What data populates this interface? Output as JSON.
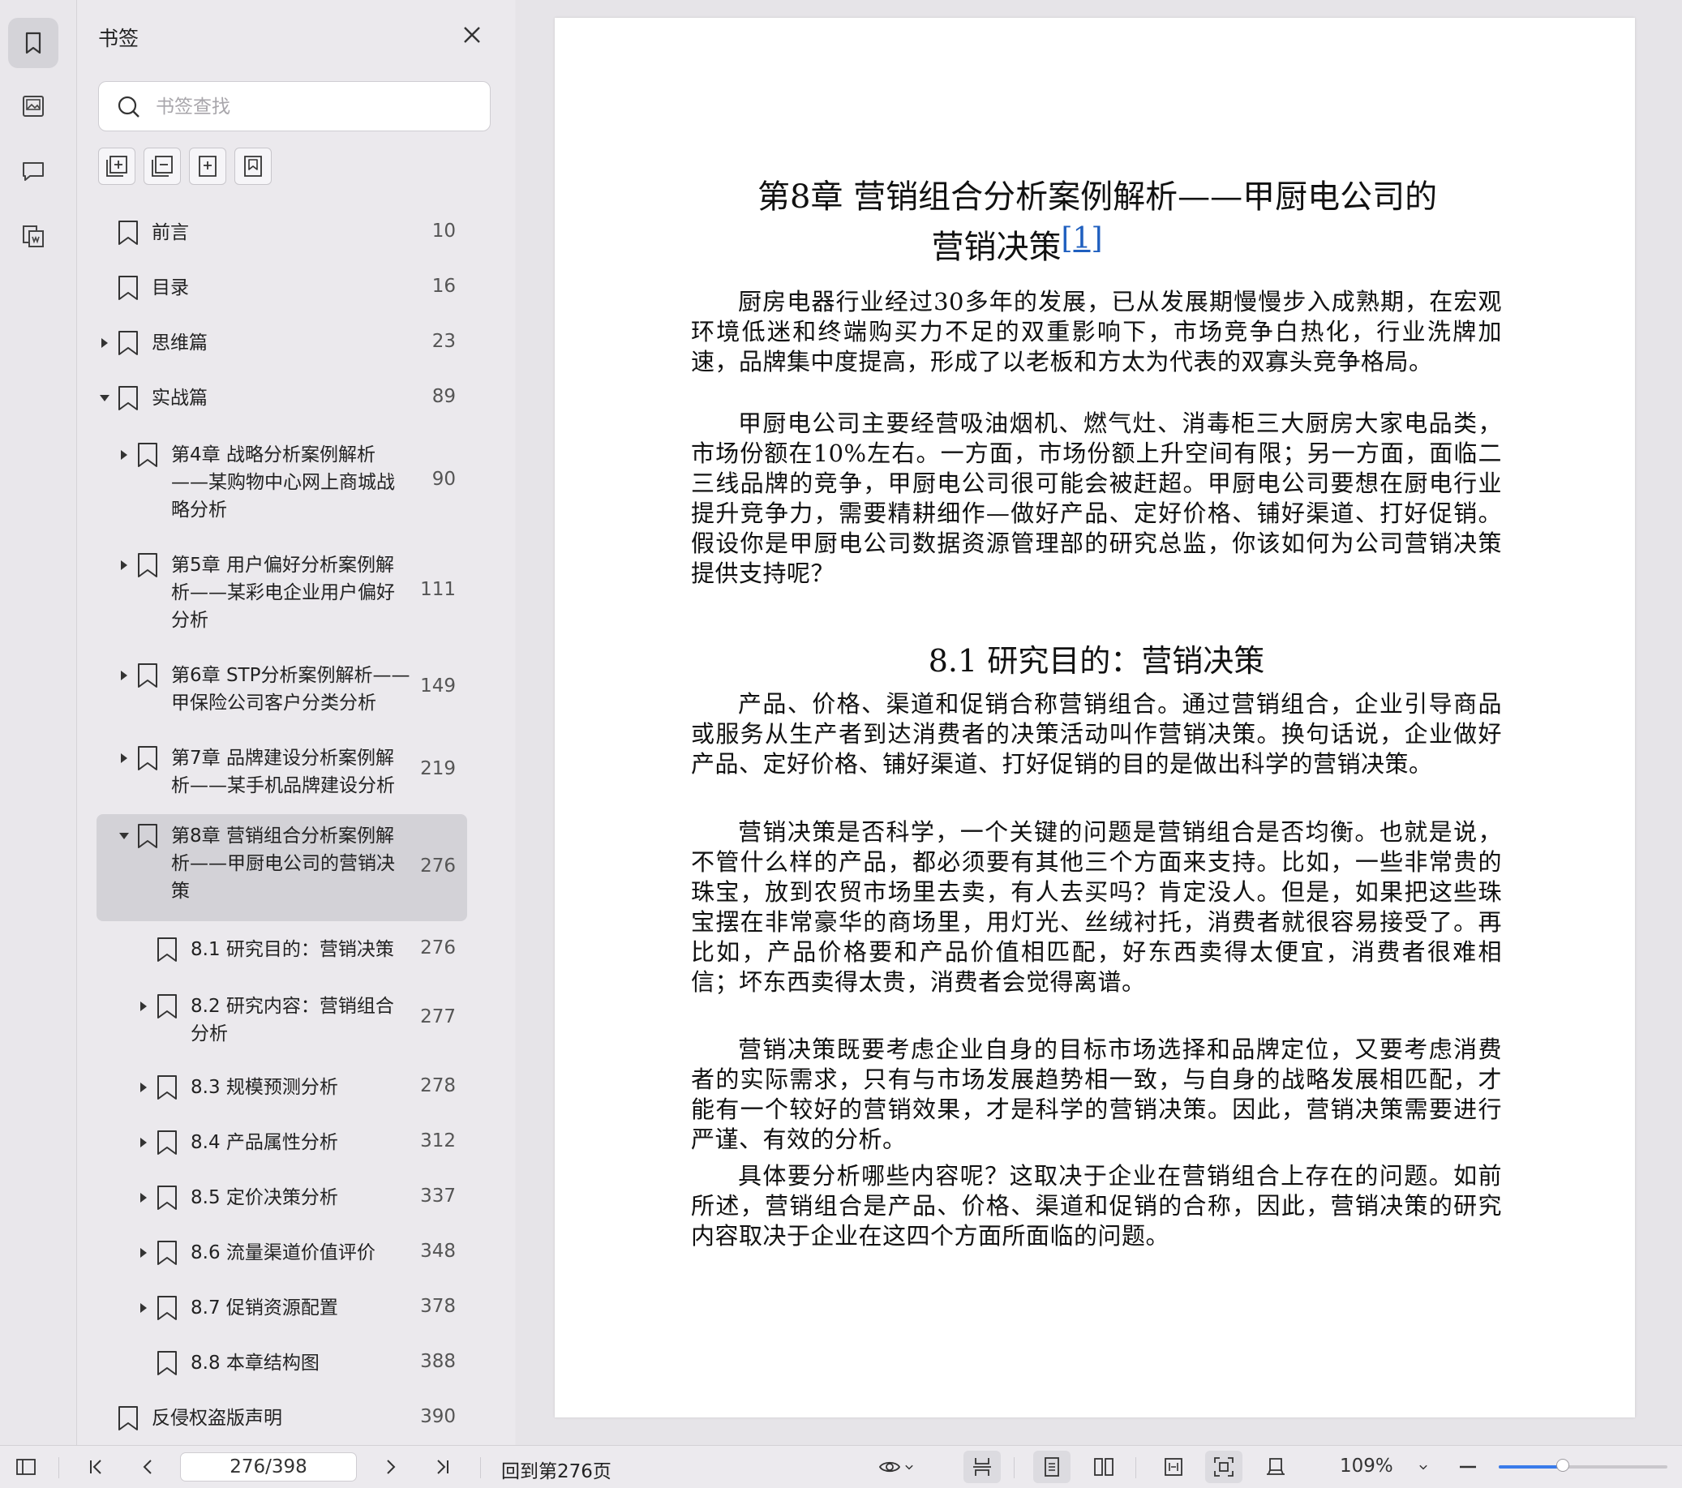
{
  "panel": {
    "title": "书签",
    "search_placeholder": "书签查找"
  },
  "bookmarks": [
    {
      "label": "前言",
      "page": "10"
    },
    {
      "label": "目录",
      "page": "16"
    },
    {
      "label": "思维篇",
      "page": "23"
    },
    {
      "label": "实战篇",
      "page": "89"
    },
    {
      "label": "第4章 战略分析案例解析——某购物中心网上商城战略分析",
      "page": "90"
    },
    {
      "label": "第5章 用户偏好分析案例解析——某彩电企业用户偏好分析",
      "page": "111"
    },
    {
      "label": "第6章 STP分析案例解析——甲保险公司客户分类分析",
      "page": "149"
    },
    {
      "label": "第7章 品牌建设分析案例解析——某手机品牌建设分析",
      "page": "219"
    },
    {
      "label": "第8章 营销组合分析案例解析——甲厨电公司的营销决策",
      "page": "276"
    },
    {
      "label": "8.1 研究目的：营销决策",
      "page": "276"
    },
    {
      "label": "8.2 研究内容：营销组合分析",
      "page": "277"
    },
    {
      "label": "8.3 规模预测分析",
      "page": "278"
    },
    {
      "label": "8.4 产品属性分析",
      "page": "312"
    },
    {
      "label": "8.5 定价决策分析",
      "page": "337"
    },
    {
      "label": "8.6 流量渠道价值评价",
      "page": "348"
    },
    {
      "label": "8.7 促销资源配置",
      "page": "378"
    },
    {
      "label": "8.8 本章结构图",
      "page": "388"
    },
    {
      "label": "反侵权盗版声明",
      "page": "390"
    }
  ],
  "document": {
    "chapter_title_line1": "第8章  营销组合分析案例解析——甲厨电公司的",
    "chapter_title_line2": "营销决策",
    "footnote_ref": "[1]",
    "para1": "厨房电器行业经过30多年的发展，已从发展期慢慢步入成熟期，在宏观环境低迷和终端购买力不足的双重影响下，市场竞争白热化，行业洗牌加速，品牌集中度提高，形成了以老板和方太为代表的双寡头竞争格局。",
    "para2": "甲厨电公司主要经营吸油烟机、燃气灶、消毒柜三大厨房大家电品类，市场份额在10%左右。一方面，市场份额上升空间有限；另一方面，面临二三线品牌的竞争，甲厨电公司很可能会被赶超。甲厨电公司要想在厨电行业提升竞争力，需要精耕细作—做好产品、定好价格、铺好渠道、打好促销。假设你是甲厨电公司数据资源管理部的研究总监，你该如何为公司营销决策提供支持呢？",
    "section_title": "8.1  研究目的：营销决策",
    "para3": "产品、价格、渠道和促销合称营销组合。通过营销组合，企业引导商品或服务从生产者到达消费者的决策活动叫作营销决策。换句话说，企业做好产品、定好价格、铺好渠道、打好促销的目的是做出科学的营销决策。",
    "para4": "营销决策是否科学，一个关键的问题是营销组合是否均衡。也就是说，不管什么样的产品，都必须要有其他三个方面来支持。比如，一些非常贵的珠宝，放到农贸市场里去卖，有人去买吗？肯定没人。但是，如果把这些珠宝摆在非常豪华的商场里，用灯光、丝绒衬托，消费者就很容易接受了。再比如，产品价格要和产品价值相匹配，好东西卖得太便宜，消费者很难相信；坏东西卖得太贵，消费者会觉得离谱。",
    "para5": "营销决策既要考虑企业自身的目标市场选择和品牌定位，又要考虑消费者的实际需求，只有与市场发展趋势相一致，与自身的战略发展相匹配，才能有一个较好的营销效果，才是科学的营销决策。因此，营销决策需要进行严谨、有效的分析。",
    "para6": "具体要分析哪些内容呢？这取决于企业在营销组合上存在的问题。如前所述，营销组合是产品、价格、渠道和促销的合称，因此，营销决策的研究内容取决于企业在这四个方面所面临的问题。"
  },
  "bottombar": {
    "page_value": "276/398",
    "goto_label": "回到第276页",
    "zoom_label": "109%",
    "zoom_level": 0.38
  }
}
